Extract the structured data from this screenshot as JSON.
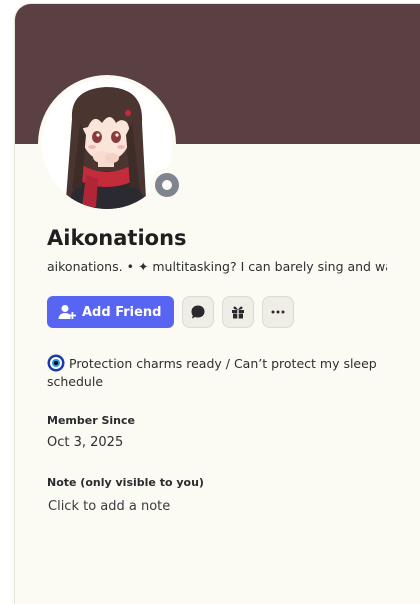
{
  "profile": {
    "display_name": "Aikonations",
    "username": "aikonations.",
    "separator": "•",
    "bio_preview": "✦ multitasking? I can barely sing and wa",
    "status": "offline"
  },
  "actions": {
    "add_friend_label": "Add Friend",
    "message_icon": "chat-bubble-icon",
    "gift_icon": "gift-icon",
    "more_icon": "ellipsis-icon"
  },
  "custom_status": {
    "emoji": "nazar-amulet-icon",
    "text": "Protection charms ready / Can’t protect my sleep schedule"
  },
  "member_since": {
    "label": "Member Since",
    "value": "Oct 3, 2025"
  },
  "note": {
    "label": "Note (only visible to you)",
    "placeholder": "Click to add a note"
  },
  "colors": {
    "banner": "#5a3f43",
    "card_background": "#fbfaf3",
    "primary_button": "#5865f2",
    "status_offline": "#80848e"
  }
}
